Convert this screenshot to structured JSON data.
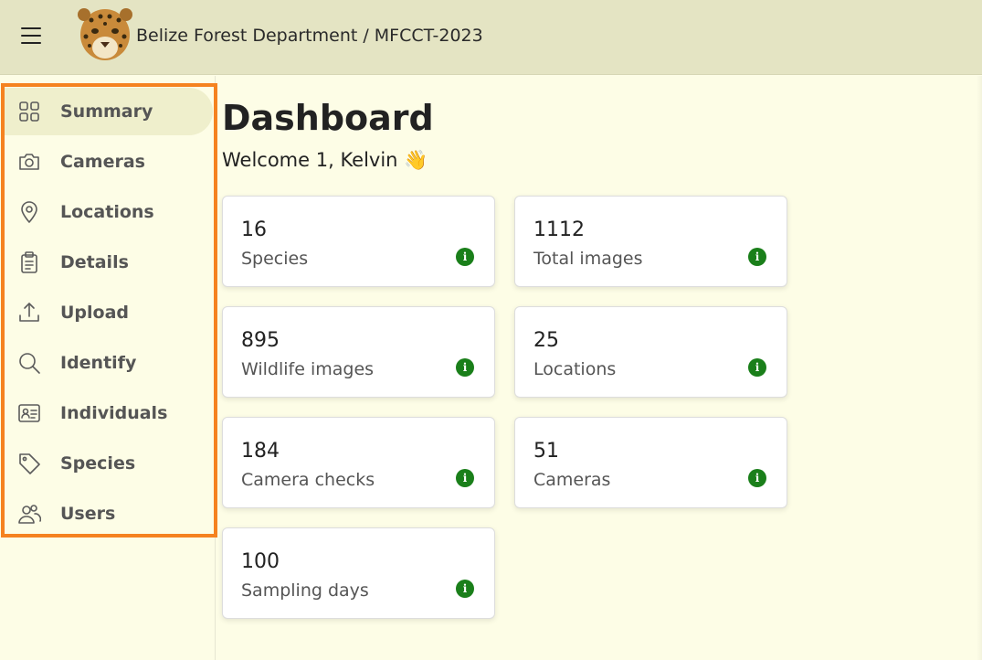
{
  "header": {
    "title": "Belize Forest Department / MFCCT-2023",
    "logo_icon": "jaguar-logo"
  },
  "sidebar": {
    "items": [
      {
        "label": "Summary",
        "icon": "grid-icon",
        "active": true
      },
      {
        "label": "Cameras",
        "icon": "camera-icon",
        "active": false
      },
      {
        "label": "Locations",
        "icon": "location-pin-icon",
        "active": false
      },
      {
        "label": "Details",
        "icon": "clipboard-icon",
        "active": false
      },
      {
        "label": "Upload",
        "icon": "upload-icon",
        "active": false
      },
      {
        "label": "Identify",
        "icon": "search-icon",
        "active": false
      },
      {
        "label": "Individuals",
        "icon": "id-card-icon",
        "active": false
      },
      {
        "label": "Species",
        "icon": "tag-icon",
        "active": false
      },
      {
        "label": "Users",
        "icon": "users-icon",
        "active": false
      }
    ]
  },
  "main": {
    "title": "Dashboard",
    "welcome": "Welcome 1, Kelvin 👋",
    "cards": [
      {
        "value": "16",
        "label": "Species"
      },
      {
        "value": "1112",
        "label": "Total images"
      },
      {
        "value": "895",
        "label": "Wildlife images"
      },
      {
        "value": "25",
        "label": "Locations"
      },
      {
        "value": "184",
        "label": "Camera checks"
      },
      {
        "value": "51",
        "label": "Cameras"
      },
      {
        "value": "100",
        "label": "Sampling days"
      }
    ]
  },
  "colors": {
    "topbar": "#e4e4c3",
    "background": "#fdfde6",
    "highlight_frame": "#f58220",
    "active_item": "#efefcc",
    "info_icon": "#1a7f1a"
  }
}
